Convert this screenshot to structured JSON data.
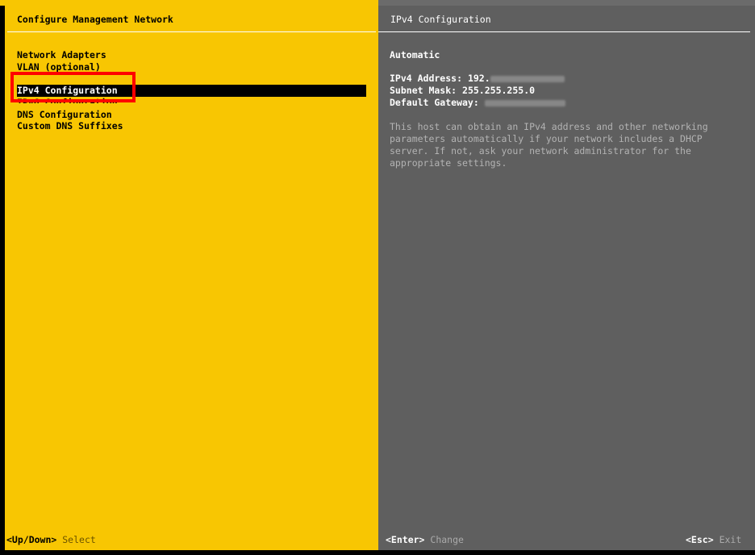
{
  "left_panel": {
    "title": "Configure Management Network",
    "menu": [
      {
        "label": "Network Adapters",
        "selected": false
      },
      {
        "label": "VLAN (optional)",
        "selected": false
      },
      {
        "label": "IPv4 Configuration",
        "selected": true
      },
      {
        "label": "IPv6 Configuration",
        "selected": false
      },
      {
        "label": "DNS Configuration",
        "selected": false
      },
      {
        "label": "Custom DNS Suffixes",
        "selected": false
      }
    ]
  },
  "right_panel": {
    "title": "IPv4 Configuration",
    "mode": "Automatic",
    "ipv4_address_label": "IPv4 Address:",
    "ipv4_address_value": "192.",
    "subnet_mask_label": "Subnet Mask:",
    "subnet_mask_value": "255.255.255.0",
    "default_gateway_label": "Default Gateway:",
    "description": "This host can obtain an IPv4 address and other networking parameters automatically if your network includes a DHCP server. If not, ask your network administrator for the appropriate settings."
  },
  "footer": {
    "updown_key": "<Up/Down>",
    "updown_action": "Select",
    "enter_key": "<Enter>",
    "enter_action": "Change",
    "esc_key": "<Esc>",
    "esc_action": "Exit"
  },
  "colors": {
    "left_bg": "#f8c602",
    "right_bg": "#5f5f5f",
    "highlight": "#ff0000"
  }
}
